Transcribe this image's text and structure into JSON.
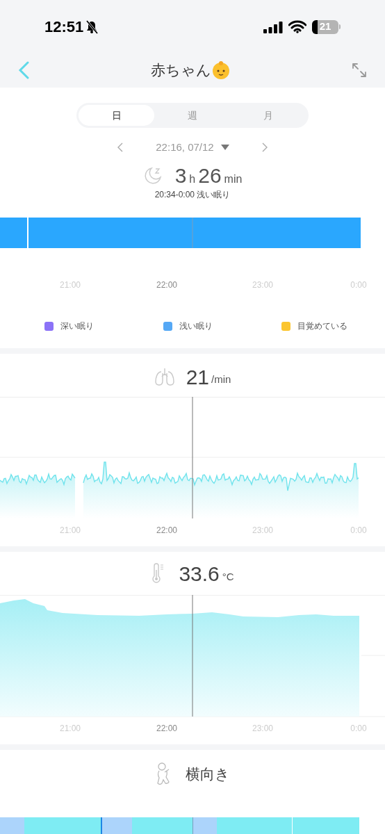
{
  "status_bar": {
    "time": "12:51",
    "battery": "21"
  },
  "header": {
    "title": "赤ちゃん"
  },
  "tabs": [
    {
      "label": "日",
      "selected": true
    },
    {
      "label": "週",
      "selected": false
    },
    {
      "label": "月",
      "selected": false
    }
  ],
  "date_nav": {
    "label": "22:16, 07/12"
  },
  "sleep_summary": {
    "hours": "3",
    "hours_unit": "h",
    "minutes": "26",
    "minutes_unit": "min",
    "detail": "20:34-0:00 浅い眠り"
  },
  "sleep_chart": {
    "x_labels": [
      {
        "label": "21:00",
        "highlighted": false
      },
      {
        "label": "22:00",
        "highlighted": true
      },
      {
        "label": "23:00",
        "highlighted": false
      },
      {
        "label": "0:00",
        "highlighted": false
      }
    ],
    "legend": [
      {
        "label": "深い眠り",
        "color": "#8b72f7"
      },
      {
        "label": "浅い眠り",
        "color": "#55a8f5"
      },
      {
        "label": "目覚めている",
        "color": "#fbc52f"
      }
    ]
  },
  "respiration": {
    "value": "21",
    "unit": "/min",
    "x_labels": [
      {
        "label": "21:00",
        "highlighted": false
      },
      {
        "label": "22:00",
        "highlighted": true
      },
      {
        "label": "23:00",
        "highlighted": false
      },
      {
        "label": "0:00",
        "highlighted": false
      }
    ]
  },
  "temperature": {
    "value": "33.6",
    "unit": "°C",
    "x_labels": [
      {
        "label": "21:00",
        "highlighted": false
      },
      {
        "label": "22:00",
        "highlighted": true
      },
      {
        "label": "23:00",
        "highlighted": false
      },
      {
        "label": "0:00",
        "highlighted": false
      }
    ]
  },
  "position": {
    "label": "横向き"
  }
}
